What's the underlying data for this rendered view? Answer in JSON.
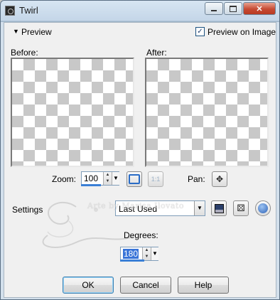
{
  "window": {
    "title": "Twirl"
  },
  "preview": {
    "toggle_label": "Preview",
    "preview_on_image_label": "Preview on Image",
    "preview_on_image_checked": true,
    "before_label": "Before:",
    "after_label": "After:"
  },
  "zoom": {
    "label": "Zoom:",
    "value": "100",
    "ratio_label": "1:1"
  },
  "pan": {
    "label": "Pan:"
  },
  "settings": {
    "label": "Settings",
    "preset_value": "Last Used"
  },
  "degrees": {
    "label": "Degrees:",
    "value": "180"
  },
  "watermark": {
    "text": "Arte by Marisa Ilovato"
  },
  "buttons": {
    "ok": "OK",
    "cancel": "Cancel",
    "help": "Help"
  },
  "icons": {
    "minimize": "minimize-icon",
    "maximize": "maximize-icon",
    "close": "close-icon",
    "fit": "fit-to-window-icon",
    "pan": "pan-move-icon",
    "save": "save-preset-icon",
    "randomize": "randomize-dice-icon",
    "reset": "reset-icon"
  }
}
